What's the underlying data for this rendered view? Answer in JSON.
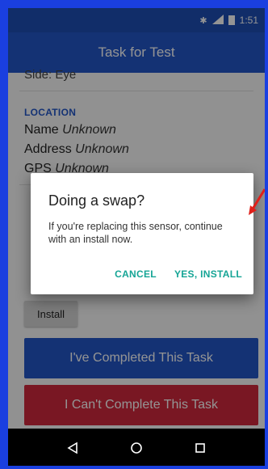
{
  "status_bar": {
    "time": "1:51",
    "bluetooth_icon": "bluetooth-icon",
    "signal_icon": "signal-icon",
    "battery_icon": "battery-icon"
  },
  "app_bar": {
    "title": "Task for Test"
  },
  "content": {
    "previous_line": "Side: Eye",
    "location": {
      "label": "LOCATION",
      "name_key": "Name",
      "name_val": "Unknown",
      "address_key": "Address",
      "address_val": "Unknown",
      "gps_key": "GPS",
      "gps_val": "Unknown"
    },
    "install_button": "Install",
    "complete_button": "I've Completed This Task",
    "cant_button": "I Can't Complete This Task"
  },
  "dialog": {
    "title": "Doing a swap?",
    "message": "If you're replacing this sensor, continue with an install now.",
    "cancel": "CANCEL",
    "confirm": "YES, INSTALL"
  },
  "nav": {
    "back_icon": "back-icon",
    "home_icon": "home-icon",
    "recents_icon": "recents-icon"
  },
  "colors": {
    "frame": "#1a3fe0",
    "primary": "#2457c9",
    "danger": "#d1283d",
    "accent": "#16a596"
  }
}
